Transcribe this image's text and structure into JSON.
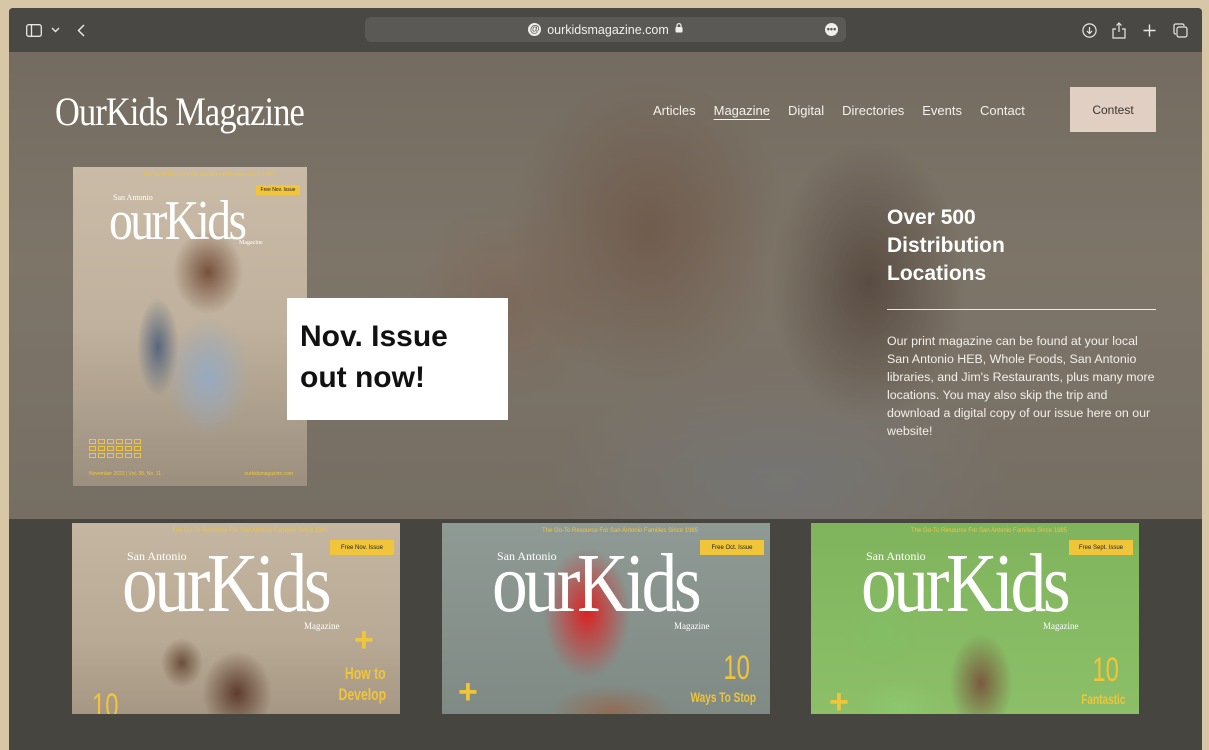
{
  "browser": {
    "url": "ourkidsmagazine.com",
    "icons": {
      "sidebar": "sidebar-icon",
      "chevron": "chevron-down-icon",
      "back": "back-icon",
      "download": "download-icon",
      "share": "share-icon",
      "new_tab": "plus-icon",
      "tabs": "tabs-icon"
    }
  },
  "site": {
    "logo": "OurKids Magazine",
    "nav": [
      "Articles",
      "Magazine",
      "Digital",
      "Directories",
      "Events",
      "Contact"
    ],
    "active_nav": "Magazine",
    "contest_label": "Contest",
    "accent_color": "#e2cfc3"
  },
  "hero": {
    "issue_callout": "Nov. Issue out now!",
    "distribution_title": "Over 500 Distribution Locations",
    "distribution_body": "Our print magazine can be found at your local San Antonio HEB, Whole Foods, San Antonio libraries, and Jim's Restaurants, plus many more locations. You may also skip the trip and download a digital copy of our issue here on our website!",
    "cover": {
      "tagline": "The Go-To Resource For San Antonio Families Since 1985",
      "free_badge": "Free Nov. Issue",
      "city": "San Antonio",
      "masthead": "ourKids",
      "sub": "Magazine",
      "date": "November 2023 | Vol. 38, No. 11",
      "url": "ourkidsmagazine.com"
    }
  },
  "covers": [
    {
      "tagline": "The Go-To Resource For San Antonio Families Since 1985",
      "free_badge": "Free Nov. Issue",
      "city": "San Antonio",
      "masthead": "ourKids",
      "sub": "Magazine",
      "number": "10",
      "headline": "How to Develop",
      "headline_lines": [
        "How to",
        "Develop"
      ]
    },
    {
      "tagline": "The Go-To Resource For San Antonio Families Since 1985",
      "free_badge": "Free Oct. Issue",
      "city": "San Antonio",
      "masthead": "ourKids",
      "sub": "Magazine",
      "number": "10",
      "headline": "Ways To Stop"
    },
    {
      "tagline": "The Go-To Resource For San Antonio Families Since 1985",
      "free_badge": "Free Sept. Issue",
      "city": "San Antonio",
      "masthead": "ourKids",
      "sub": "Magazine",
      "number": "10",
      "headline": "Fantastic"
    }
  ]
}
